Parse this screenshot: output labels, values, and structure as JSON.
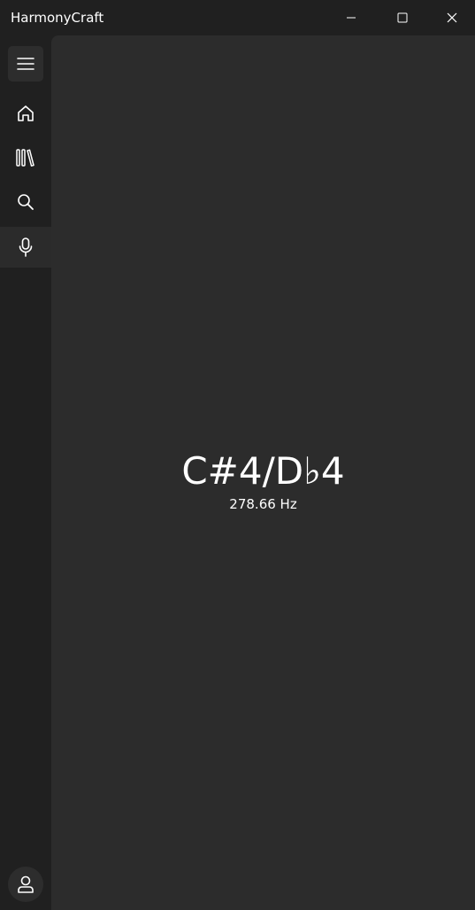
{
  "window": {
    "title": "HarmonyCraft",
    "controls": [
      "minimize-icon",
      "maximize-icon",
      "close-icon"
    ]
  },
  "sidebar": {
    "items": [
      {
        "id": "menu",
        "icon": "hamburger-menu-icon"
      },
      {
        "id": "home",
        "icon": "home-icon"
      },
      {
        "id": "library",
        "icon": "library-icon"
      },
      {
        "id": "search",
        "icon": "search-icon"
      },
      {
        "id": "tuner",
        "icon": "microphone-icon",
        "selected": true
      }
    ],
    "footer": {
      "id": "profile",
      "icon": "user-icon"
    }
  },
  "tuner": {
    "note": "C#4/D♭4",
    "frequency": "278.66 Hz"
  },
  "colors": {
    "sidebar_bg": "#202020",
    "content_bg": "#2c2c2c",
    "selected_item_bg": "#2b2b2b",
    "text": "#ffffff"
  }
}
